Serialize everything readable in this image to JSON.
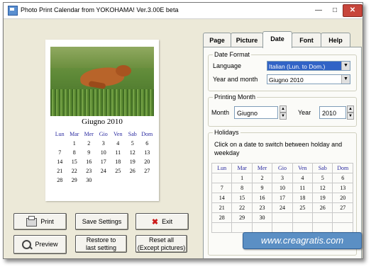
{
  "window": {
    "title": "Photo Print Calendar from YOKOHAMA! Ver.3.00E beta",
    "min_glyph": "—",
    "max_glyph": "□",
    "close_glyph": "✕"
  },
  "preview": {
    "month_title": "Giugno 2010",
    "weekdays": [
      "Lun",
      "Mar",
      "Mer",
      "Gio",
      "Ven",
      "Sab",
      "Dom"
    ],
    "weeks": [
      [
        "",
        "1",
        "2",
        "3",
        "4",
        "5",
        "6"
      ],
      [
        "7",
        "8",
        "9",
        "10",
        "11",
        "12",
        "13"
      ],
      [
        "14",
        "15",
        "16",
        "17",
        "18",
        "19",
        "20"
      ],
      [
        "21",
        "22",
        "23",
        "24",
        "25",
        "26",
        "27"
      ],
      [
        "28",
        "29",
        "30",
        "",
        "",
        "",
        ""
      ]
    ]
  },
  "buttons": {
    "print": "Print",
    "save_settings": "Save Settings",
    "exit": "Exit",
    "preview": "Preview",
    "restore_line1": "Restore to",
    "restore_line2": "last setting",
    "reset_line1": "Reset all",
    "reset_line2": "(Except pictures)"
  },
  "tabs": [
    "Page",
    "Picture",
    "Date",
    "Font",
    "Help"
  ],
  "active_tab": "Date",
  "date_format": {
    "group_label": "Date Format",
    "language_label": "Language",
    "language_value": "Italian (Lun. to Dom.)",
    "year_month_label": "Year and month",
    "year_month_value": "Giugno 2010"
  },
  "printing_month": {
    "group_label": "Printing Month",
    "month_label": "Month",
    "month_value": "Giugno",
    "year_label": "Year",
    "year_value": "2010"
  },
  "holidays": {
    "group_label": "Holidays",
    "instruction": "Click on a date to switch between holday and weekday",
    "weekdays": [
      "Lun",
      "Mar",
      "Mer",
      "Gio",
      "Ven",
      "Sab",
      "Dom"
    ],
    "weeks": [
      [
        "",
        "1",
        "2",
        "3",
        "4",
        "5",
        "6"
      ],
      [
        "7",
        "8",
        "9",
        "10",
        "11",
        "12",
        "13"
      ],
      [
        "14",
        "15",
        "16",
        "17",
        "18",
        "19",
        "20"
      ],
      [
        "21",
        "22",
        "23",
        "24",
        "25",
        "26",
        "27"
      ],
      [
        "28",
        "29",
        "30",
        "",
        "",
        "",
        ""
      ],
      [
        "",
        "",
        "",
        "",
        "",
        "",
        ""
      ]
    ]
  },
  "watermark": "www.creagratis.com",
  "colors": {
    "header_weekday": "#2a2aa0",
    "selected_combo": "#3163c6",
    "close_button": "#c7453b",
    "watermark_bg": "#5b8fc4"
  }
}
